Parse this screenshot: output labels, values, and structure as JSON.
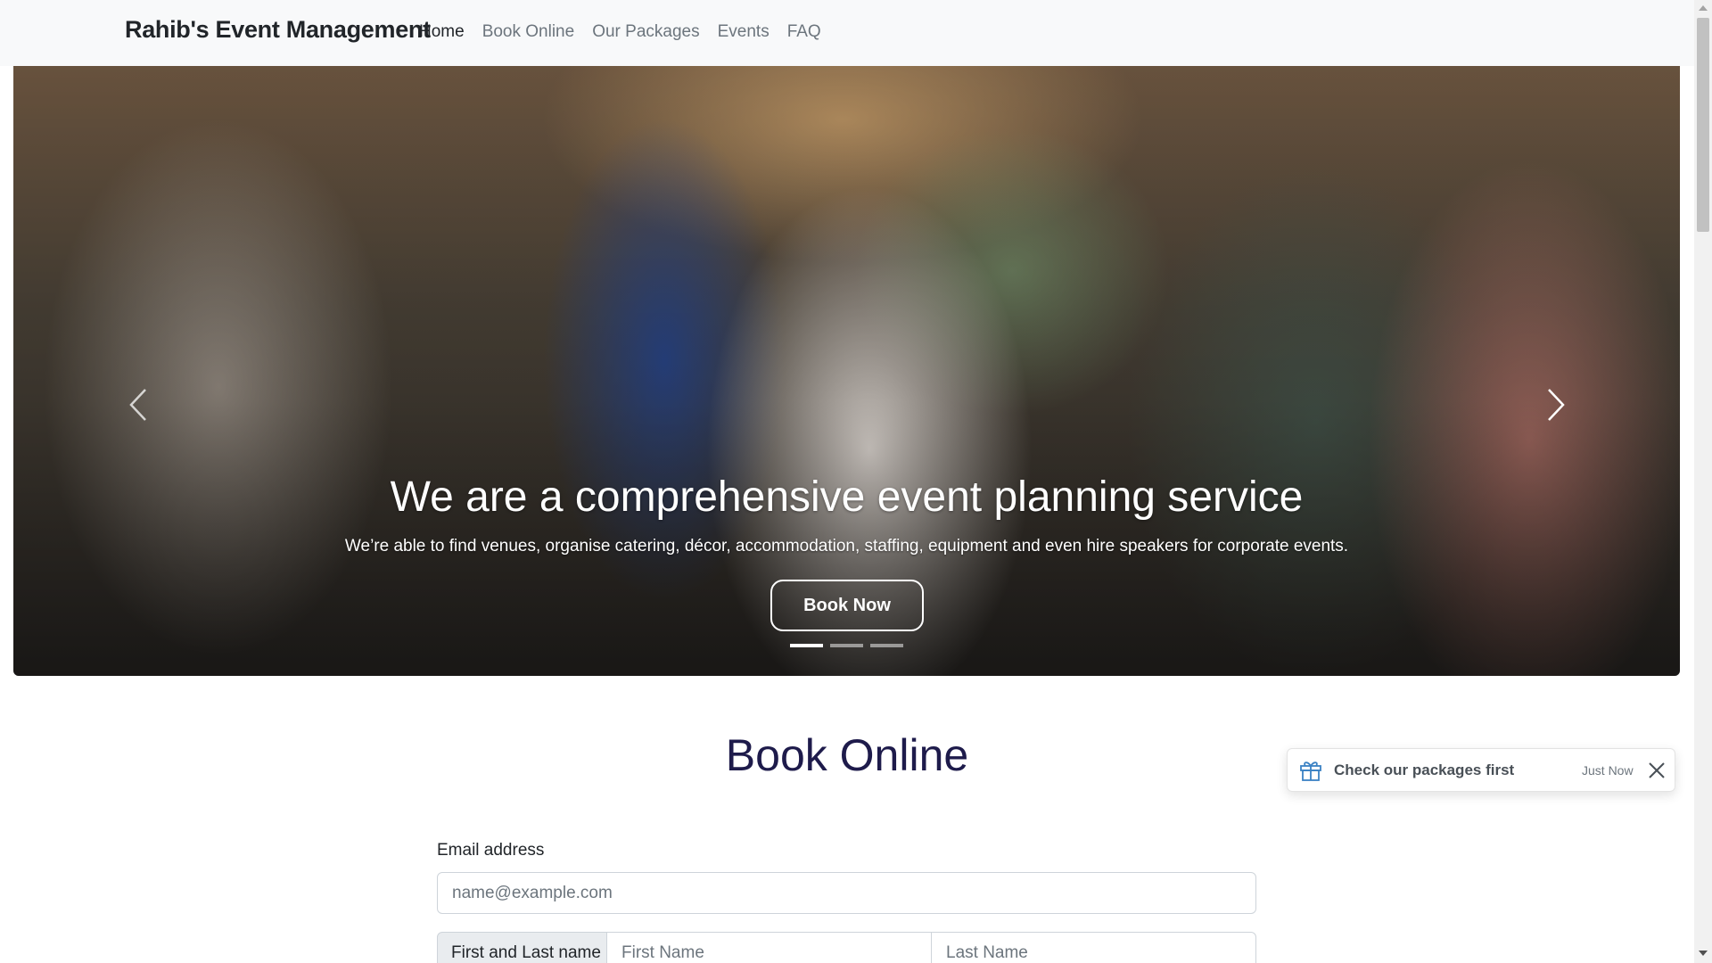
{
  "navbar": {
    "brand": "Rahib's Event Management",
    "links": [
      {
        "label": "Home",
        "active": true
      },
      {
        "label": "Book Online",
        "active": false
      },
      {
        "label": "Our Packages",
        "active": false
      },
      {
        "label": "Events",
        "active": false
      },
      {
        "label": "FAQ",
        "active": false
      }
    ]
  },
  "carousel": {
    "title": "We are a comprehensive event planning service",
    "text": "We’re able to find venues, organise catering, décor, accommodation, staffing, equipment and even hire speakers for corporate events.",
    "button_label": "Book Now",
    "prev_icon": "chevron-left-icon",
    "next_icon": "chevron-right-icon",
    "slide_count": 3,
    "active_slide": 1
  },
  "book_online": {
    "title": "Book Online",
    "email_label": "Email address",
    "email_placeholder": "name@example.com",
    "name_label": "First and Last name",
    "first_name_placeholder": "First Name",
    "last_name_placeholder": "Last Name"
  },
  "toast": {
    "icon": "gift-icon",
    "title": "Check our packages first",
    "time": "Just Now",
    "close_icon": "close-icon"
  },
  "colors": {
    "navbar_bg": "#f8f9fa",
    "heading": "#1e1b4b",
    "muted": "#6c757d",
    "input_group_bg": "#e9ecef"
  }
}
